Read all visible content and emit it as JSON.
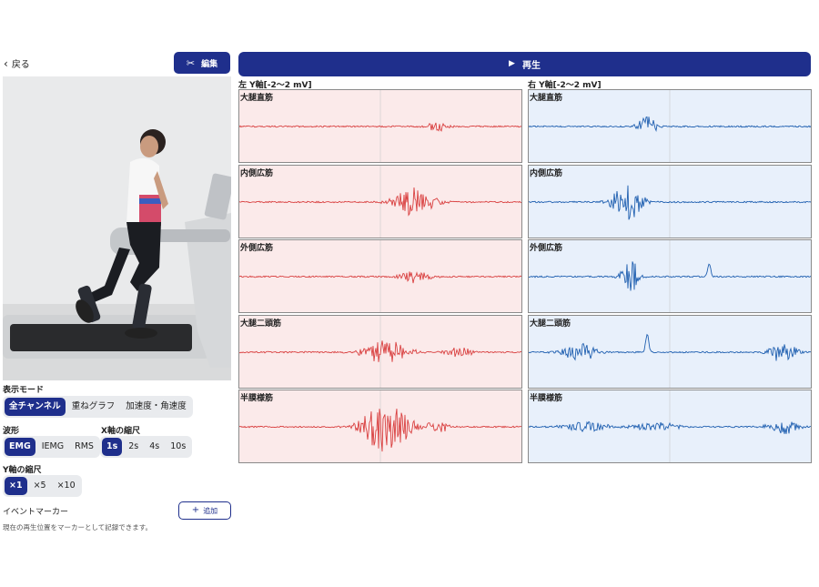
{
  "nav": {
    "back_label": "戻る",
    "edit_label": "編集",
    "play_label": "再生"
  },
  "display_mode": {
    "label": "表示モード",
    "options": [
      "全チャンネル",
      "重ねグラフ",
      "加速度・角速度"
    ],
    "selected": "全チャンネル"
  },
  "waveform": {
    "label": "波形",
    "options": [
      "EMG",
      "IEMG",
      "RMS"
    ],
    "selected": "EMG"
  },
  "x_scale": {
    "label": "X軸の縮尺",
    "options": [
      "1s",
      "2s",
      "4s",
      "10s"
    ],
    "selected": "1s"
  },
  "y_scale": {
    "label": "Y軸の縮尺",
    "options": [
      "×1",
      "×5",
      "×10"
    ],
    "selected": "×1"
  },
  "event_marker": {
    "label": "イベントマーカー",
    "add_label": "追加",
    "note": "現在の再生位置をマーカーとして記録できます。"
  },
  "left_column": {
    "title": "左 Y軸[-2〜2 mV]",
    "color": "#d94040",
    "background": "#fbeaea"
  },
  "right_column": {
    "title": "右 Y軸[-2〜2 mV]",
    "color": "#1f5fb0",
    "background": "#e8f0fb"
  },
  "channels": [
    "大腿直筋",
    "内側広筋",
    "外側広筋",
    "大腿二頭筋",
    "半膜様筋"
  ],
  "colors": {
    "accent": "#1f2f8c"
  }
}
